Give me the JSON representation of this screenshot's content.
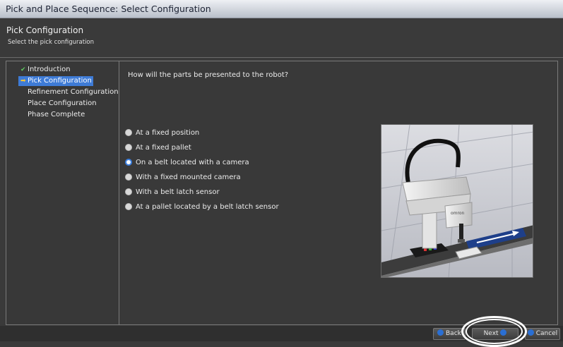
{
  "window": {
    "title": "Pick and Place Sequence: Select Configuration"
  },
  "header": {
    "title": "Pick Configuration",
    "subtitle": "Select the pick configuration"
  },
  "steps": [
    {
      "label": "Introduction",
      "state": "done",
      "icon": "check-icon"
    },
    {
      "label": "Pick Configuration",
      "state": "current",
      "icon": "arrow-right-icon"
    },
    {
      "label": "Refinement Configuration",
      "state": "pending"
    },
    {
      "label": "Place Configuration",
      "state": "pending"
    },
    {
      "label": "Phase Complete",
      "state": "pending"
    }
  ],
  "main": {
    "question": "How will the parts be presented to the robot?",
    "options": [
      {
        "label": "At a fixed position",
        "checked": false
      },
      {
        "label": "At a fixed pallet",
        "checked": false
      },
      {
        "label": "On a belt located with a camera",
        "checked": true
      },
      {
        "label": "With a fixed mounted camera",
        "checked": false
      },
      {
        "label": "With a belt latch sensor",
        "checked": false
      },
      {
        "label": "At a pallet located by a belt latch sensor",
        "checked": false
      }
    ],
    "illustration": {
      "robot_brand": "omron"
    }
  },
  "footer": {
    "back_label": "Back",
    "next_label": "Next",
    "cancel_label": "Cancel"
  },
  "colors": {
    "accent": "#3e7bd6",
    "check": "#5ec85e",
    "current_marker": "#f0c23b",
    "background": "#3a3a3a"
  }
}
